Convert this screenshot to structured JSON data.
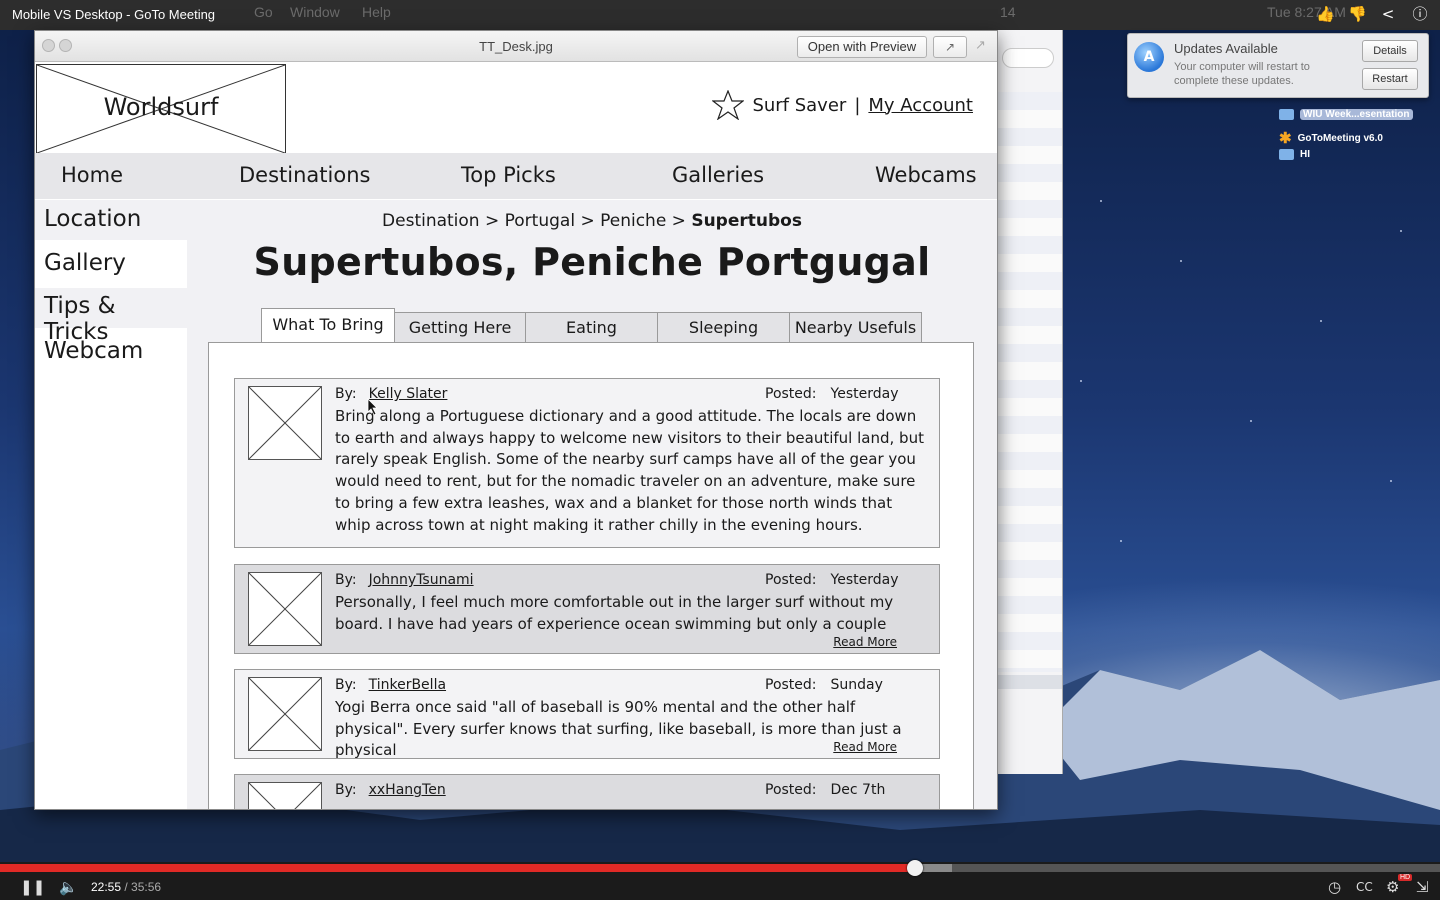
{
  "video": {
    "title": "Mobile VS Desktop - GoTo Meeting",
    "current_time": "22:55",
    "duration": "/ 35:56",
    "progress_fraction": 0.636,
    "hd_badge": "HD"
  },
  "menubar": {
    "ghost_items": [
      "Go",
      "Window",
      "Help"
    ],
    "ghost_right": [
      "14",
      "Tue 8:27 AM"
    ]
  },
  "notification": {
    "title": "Updates Available",
    "body": "Your computer will restart to complete these updates.",
    "details_label": "Details",
    "restart_label": "Restart"
  },
  "desktop_items": [
    {
      "label": "WIU Week...esentation",
      "kind": "folder"
    },
    {
      "label": "GoToMeeting v6.0",
      "kind": "app"
    },
    {
      "label": "HI",
      "kind": "folder"
    }
  ],
  "preview_window": {
    "title": "TT_Desk.jpg",
    "open_with_label": "Open with Preview"
  },
  "wireframe": {
    "logo": "Worldsurf",
    "surf_saver": "Surf Saver",
    "separator": "|",
    "my_account": "My Account",
    "nav": [
      "Home",
      "Destinations",
      "Top Picks",
      "Galleries",
      "Webcams"
    ],
    "sidebar": [
      "Location",
      "Gallery",
      "Tips & Tricks",
      "Webcam"
    ],
    "breadcrumb": {
      "path": "Destination > Portugal > Peniche > ",
      "current": "Supertubos"
    },
    "page_title": "Supertubos, Peniche Portgugal",
    "tabs": [
      "What To Bring",
      "Getting Here",
      "Eating",
      "Sleeping",
      "Nearby Usefuls"
    ],
    "by_label": "By:",
    "posted_label": "Posted:",
    "read_more": "Read More",
    "posts": [
      {
        "author": "Kelly Slater",
        "posted": "Yesterday",
        "body": "Bring along a Portuguese dictionary and a good attitude. The locals are down to earth and always happy to welcome new visitors to their beautiful land, but rarely speak English. Some of the nearby surf camps have all of the gear you would need to rent, but for the nomadic traveler on an adventure, make sure to bring a few extra leashes, wax and a blanket for those north winds that whip across town at night making it rather chilly in the evening hours."
      },
      {
        "author": "JohnnyTsunami",
        "posted": "Yesterday",
        "body": "Personally, I feel much more comfortable out in the larger surf without my board. I have had years of experience ocean swimming but only a couple"
      },
      {
        "author": "TinkerBella",
        "posted": "Sunday",
        "body": "Yogi Berra once said \"all of baseball is 90% mental and the other half physical\". Every surfer knows that surfing, like baseball, is more than just a physical"
      },
      {
        "author": "xxHangTen",
        "posted": "Dec 7th",
        "body": ""
      }
    ]
  }
}
